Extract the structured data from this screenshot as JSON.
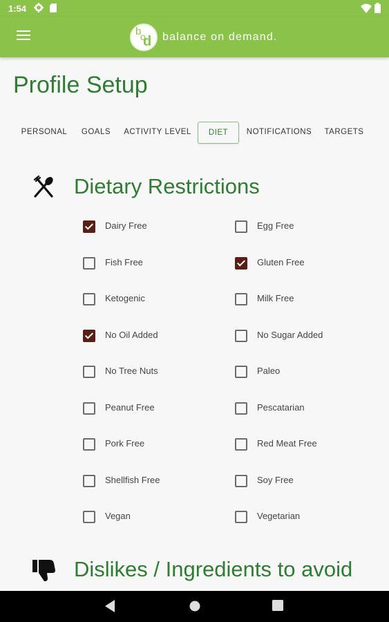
{
  "status_bar": {
    "time": "1:54"
  },
  "app_bar": {
    "brand_text": "balance on demand."
  },
  "page": {
    "title": "Profile Setup"
  },
  "tabs": [
    {
      "label": "PERSONAL",
      "active": false
    },
    {
      "label": "GOALS",
      "active": false
    },
    {
      "label": "ACTIVITY LEVEL",
      "active": false
    },
    {
      "label": "DIET",
      "active": true
    },
    {
      "label": "NOTIFICATIONS",
      "active": false
    },
    {
      "label": "TARGETS",
      "active": false
    }
  ],
  "dietary": {
    "title": "Dietary Restrictions",
    "icon": "fork-spoon-icon",
    "options": [
      {
        "label": "Dairy Free",
        "checked": true
      },
      {
        "label": "Egg Free",
        "checked": false
      },
      {
        "label": "Fish Free",
        "checked": false
      },
      {
        "label": "Gluten Free",
        "checked": true
      },
      {
        "label": "Ketogenic",
        "checked": false
      },
      {
        "label": "Milk Free",
        "checked": false
      },
      {
        "label": "No Oil Added",
        "checked": true
      },
      {
        "label": "No Sugar Added",
        "checked": false
      },
      {
        "label": "No Tree Nuts",
        "checked": false
      },
      {
        "label": "Paleo",
        "checked": false
      },
      {
        "label": "Peanut Free",
        "checked": false
      },
      {
        "label": "Pescatarian",
        "checked": false
      },
      {
        "label": "Pork Free",
        "checked": false
      },
      {
        "label": "Red Meat Free",
        "checked": false
      },
      {
        "label": "Shellfish Free",
        "checked": false
      },
      {
        "label": "Soy Free",
        "checked": false
      },
      {
        "label": "Vegan",
        "checked": false
      },
      {
        "label": "Vegetarian",
        "checked": false
      }
    ]
  },
  "dislikes": {
    "title": "Dislikes / Ingredients to avoid",
    "icon": "thumbs-down-icon"
  },
  "colors": {
    "brand_green": "#8bc34a",
    "title_green": "#2e7d32",
    "checkbox_checked": "#5a1f14"
  }
}
